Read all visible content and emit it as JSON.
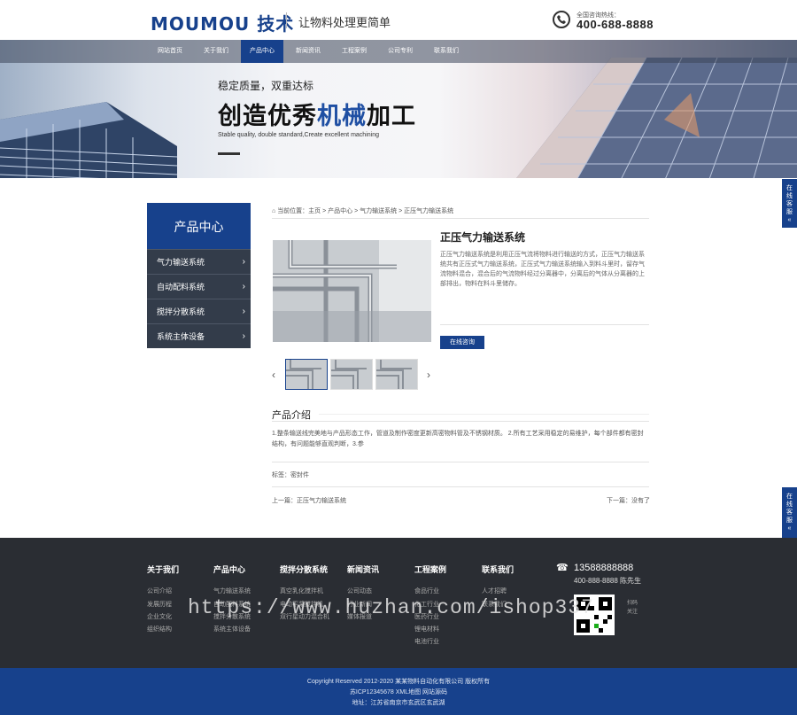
{
  "header": {
    "logo": "MOUMOU 技术",
    "slogan": "让物料处理更简单",
    "phone_label": "全国咨询热线：",
    "phone": "400-688-8888"
  },
  "nav": {
    "items": [
      "网站首页",
      "关于我们",
      "产品中心",
      "新闻资讯",
      "工程案例",
      "公司专利",
      "联系我们"
    ],
    "active_index": 2
  },
  "banner": {
    "subtitle": "稳定质量，双重达标",
    "title_prefix": "创造优秀",
    "title_highlight": "机械",
    "title_suffix": "加工",
    "english": "Stable quality, double standard,Create excellent machining"
  },
  "sidebar": {
    "title": "产品中心",
    "items": [
      {
        "label": "气力输送系统"
      },
      {
        "label": "自动配料系统"
      },
      {
        "label": "搅拌分散系统"
      },
      {
        "label": "系统主体设备"
      }
    ]
  },
  "float_tab": {
    "label": "在线客服",
    "arrow": "«"
  },
  "breadcrumb": "当前位置：主页 > 产品中心 > 气力输送系统 > 正压气力输送系统",
  "product": {
    "title": "正压气力输送系统",
    "description": "正压气力输送系统是利用正压气流将物料进行输送的方式，正压气力输送系统共有正压式气力输送系统，正压式气力输送系统输入到料斗里时，留存气流物料混合，混合后的气流物料经过分离器中，分离后的气体从分离器的上部排出，物料在料斗里储存。",
    "consult_label": "在线咨询"
  },
  "gallery": {
    "prev": "‹",
    "next": "›"
  },
  "intro": {
    "title": "产品介绍",
    "text": "1.整条输送线完美地与产品形态工作，管道及制作密度更新高密物料管及不锈钢材质。 2.所有工艺采用稳定的易维护，每个部件都有密封结构，有问题能够直观判断，3.参"
  },
  "tags": "标签：密封件",
  "pager": {
    "prev": "上一篇：正压气力输送系统",
    "next": "下一篇：没有了"
  },
  "footer": {
    "columns": [
      {
        "title": "关于我们",
        "links": [
          "公司介绍",
          "发展历程",
          "企业文化",
          "组织结构"
        ]
      },
      {
        "title": "产品中心",
        "links": [
          "气力输送系统",
          "自动配料系统",
          "搅拌分散系统",
          "系统主体设备"
        ]
      },
      {
        "title": "搅拌分散系统",
        "links": [
          "真空乳化搅拌机",
          "电动平桨搅拌机",
          "双行星动力混合机"
        ]
      },
      {
        "title": "新闻资讯",
        "links": [
          "公司动态",
          "行业新闻",
          "媒体报道"
        ]
      },
      {
        "title": "工程案例",
        "links": [
          "食品行业",
          "化工行业",
          "医药行业",
          "锂电材料",
          "电池行业"
        ]
      },
      {
        "title": "联系我们",
        "links": [
          "人才招聘",
          "联系我们"
        ]
      }
    ],
    "phone": "13588888888",
    "phone2": "400-888-8888 陈先生",
    "qr_caption": "扫码关注"
  },
  "watermark": "https://www.huzhan.com/ishop337",
  "copyright": {
    "line1": "Copyright Reserved 2012-2020 某某物料自动化有限公司 版权所有",
    "line2": "苏ICP12345678 XML地图 网站源码",
    "line3": "地址：江苏省南京市玄武区玄武湖"
  },
  "colors": {
    "brand": "#17418c",
    "footer_bg": "#2a2d33",
    "sidebar_bg": "#333c4a"
  }
}
